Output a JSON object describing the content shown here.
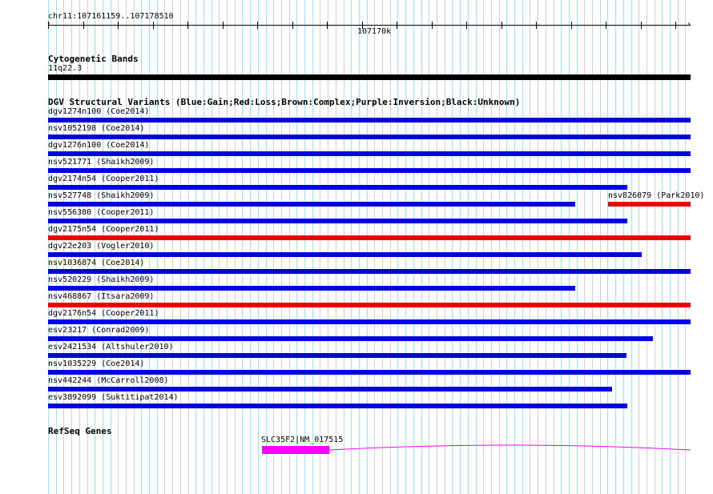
{
  "ruler": {
    "range_label": "chr11:107161159..107178510",
    "center_label": "107170k"
  },
  "cytoband": {
    "title": "Cytogenetic Bands",
    "band_label": "11q22.3",
    "color": "#000000"
  },
  "dgv": {
    "title": "DGV Structural Variants (Blue:Gain;Red:Loss;Brown:Complex;Purple:Inversion;Black:Unknown)",
    "colors": {
      "gain": "#0000e0",
      "loss": "#ee0000"
    },
    "rows": [
      [
        {
          "label": "dgv1274n100 (Coe2014)",
          "type": "gain",
          "start": 107161159,
          "end": 107178510
        }
      ],
      [
        {
          "label": "nsv1052198 (Coe2014)",
          "type": "gain",
          "start": 107161159,
          "end": 107178510
        }
      ],
      [
        {
          "label": "dgv1276n100 (Coe2014)",
          "type": "gain",
          "start": 107161159,
          "end": 107178510
        }
      ],
      [
        {
          "label": "nsv521771 (Shaikh2009)",
          "type": "gain",
          "start": 107161159,
          "end": 107178510
        }
      ],
      [
        {
          "label": "dgv2174n54 (Cooper2011)",
          "type": "gain",
          "start": 107161159,
          "end": 107176800
        }
      ],
      [
        {
          "label": "nsv527748 (Shaikh2009)",
          "type": "gain",
          "start": 107161159,
          "end": 107175400
        },
        {
          "label": "nsv826079 (Park2010)",
          "type": "loss",
          "start": 107176280,
          "end": 107178510
        }
      ],
      [
        {
          "label": "nsv556380 (Cooper2011)",
          "type": "gain",
          "start": 107161159,
          "end": 107176800
        }
      ],
      [
        {
          "label": "dgv2175n54 (Cooper2011)",
          "type": "loss",
          "start": 107161159,
          "end": 107178510
        }
      ],
      [
        {
          "label": "dgv22e203 (Vogler2010)",
          "type": "gain",
          "start": 107161159,
          "end": 107177200
        }
      ],
      [
        {
          "label": "nsv1036874 (Coe2014)",
          "type": "gain",
          "start": 107161159,
          "end": 107178510
        }
      ],
      [
        {
          "label": "nsv520229 (Shaikh2009)",
          "type": "gain",
          "start": 107161159,
          "end": 107175400
        }
      ],
      [
        {
          "label": "nsv468867 (Itsara2009)",
          "type": "loss",
          "start": 107161159,
          "end": 107178510
        }
      ],
      [
        {
          "label": "dgv2176n54 (Cooper2011)",
          "type": "gain",
          "start": 107161159,
          "end": 107178510
        }
      ],
      [
        {
          "label": "esv23217 (Conrad2009)",
          "type": "gain",
          "start": 107161159,
          "end": 107177500
        }
      ],
      [
        {
          "label": "esv2421534 (Altshuler2010)",
          "type": "gain",
          "start": 107161159,
          "end": 107176780
        }
      ],
      [
        {
          "label": "nsv1035229 (Coe2014)",
          "type": "gain",
          "start": 107161159,
          "end": 107178510
        }
      ],
      [
        {
          "label": "nsv442244 (McCarroll2008)",
          "type": "gain",
          "start": 107161159,
          "end": 107176380
        }
      ],
      [
        {
          "label": "esv3892099 (Suktitipat2014)",
          "type": "gain",
          "start": 107161159,
          "end": 107176800
        }
      ]
    ]
  },
  "refseq": {
    "title": "RefSeq Genes",
    "gene_label": "SLC35F2|NM_017515",
    "color": "#ff00ff",
    "exon": {
      "start": 107166930,
      "end": 107168750
    },
    "intron": {
      "start": 107168750,
      "end": 107178510
    }
  }
}
